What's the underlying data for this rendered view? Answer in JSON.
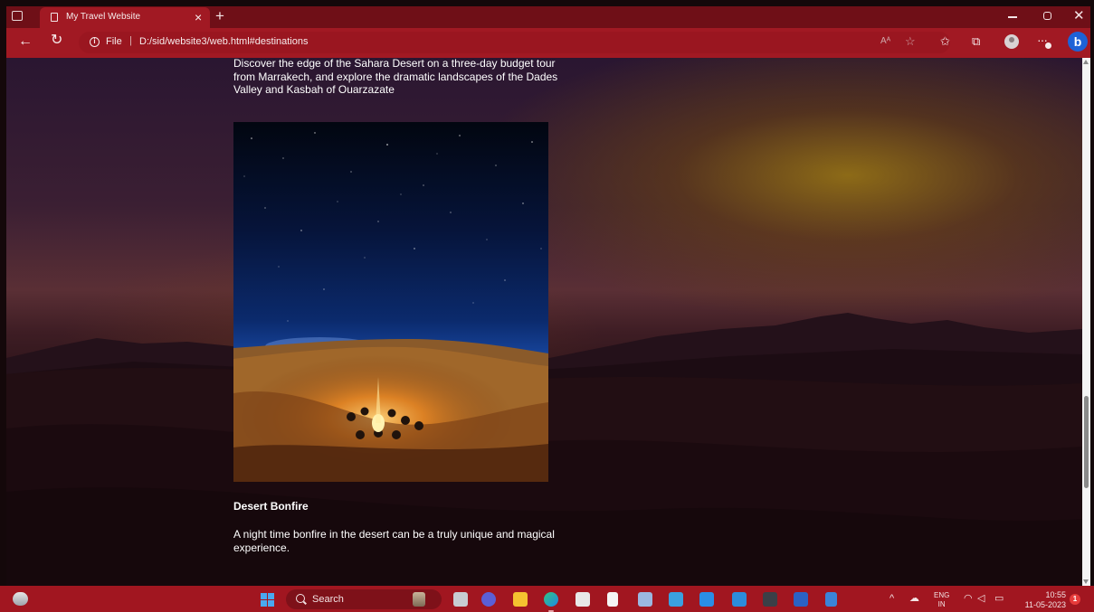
{
  "browser": {
    "tab_title": "My Travel Website",
    "tab_close": "×",
    "new_tab": "+",
    "address": {
      "scheme_label": "File",
      "separator": "|",
      "url": "D:/sid/website3/web.html#destinations"
    },
    "read_aloud": "Aᴬ"
  },
  "page": {
    "intro_text": "Discover the edge of the Sahara Desert on a three-day budget tour from Marrakech, and explore the dramatic landscapes of the Dades Valley and Kasbah of Ouarzazate",
    "card": {
      "heading": "Desert Bonfire",
      "description": "A night time bonfire in the desert can be a truly unique and magical experience."
    }
  },
  "taskbar": {
    "search_label": "Search",
    "language": {
      "line1": "ENG",
      "line2": "IN"
    },
    "time": "10:55",
    "date": "11-05-2023",
    "notification_count": "1"
  },
  "colors": {
    "title_bar": "#6f0f17",
    "toolbar": "#a11923",
    "taskbar": "#a11620",
    "edge_accent": "#1e62d6"
  }
}
